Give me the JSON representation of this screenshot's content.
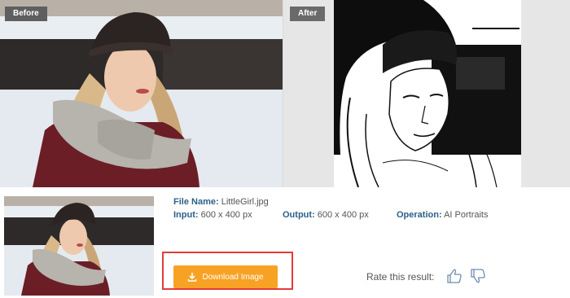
{
  "before_panel": {
    "label": "Before"
  },
  "after_panel": {
    "label": "After"
  },
  "file_info": {
    "file_name_label": "File Name:",
    "file_name": "LittleGirl.jpg",
    "input_label": "Input:",
    "input_value": "600 x 400 px",
    "output_label": "Output:",
    "output_value": "600 x 400 px",
    "operation_label": "Operation:",
    "operation_value": "AI Portraits"
  },
  "download": {
    "label": "Download Image"
  },
  "rating": {
    "label": "Rate this result:"
  },
  "colors": {
    "accent": "#f7a224",
    "highlight_border": "#e23b3b",
    "label_blue": "#2b5f89",
    "tag_bg": "#5f5f5f"
  },
  "icons": [
    "download-icon",
    "thumbs-up-icon",
    "thumbs-down-icon"
  ]
}
